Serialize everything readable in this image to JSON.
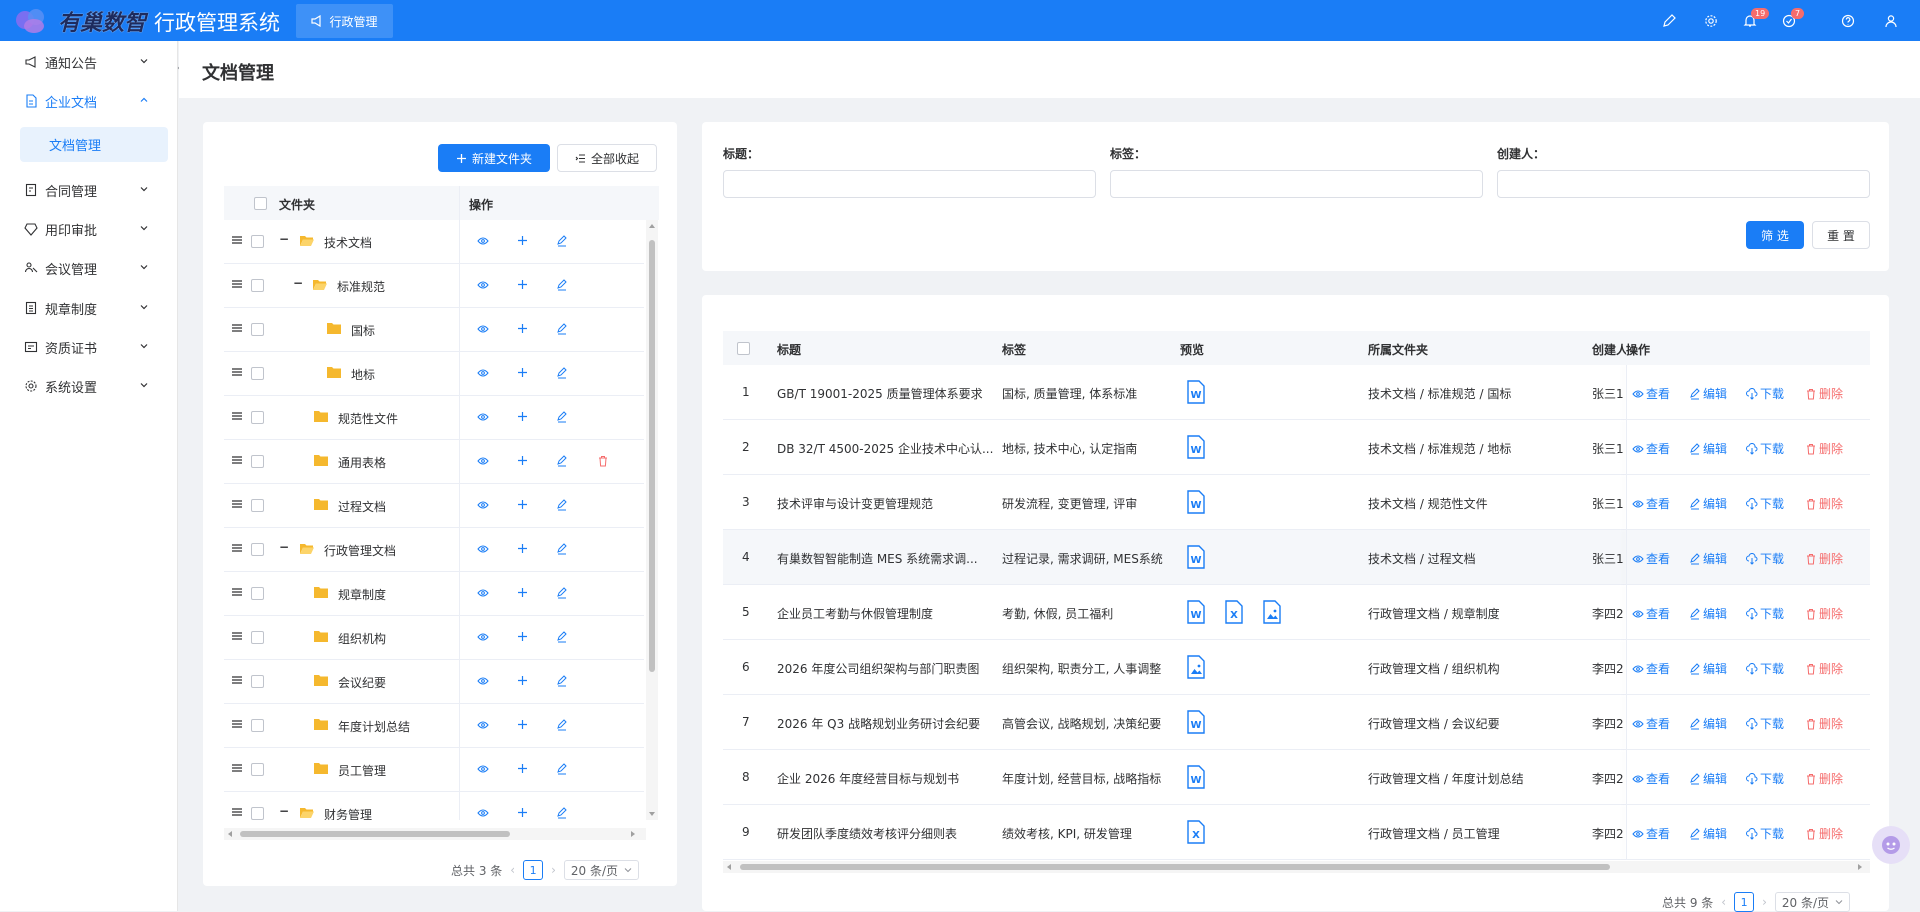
{
  "app": {
    "logo_text": "有巢数智",
    "title": "行政管理系统",
    "top_tab": "行政管理",
    "badges": {
      "notice": "19",
      "task": "7"
    }
  },
  "sidebar": {
    "items": [
      {
        "label": "通知公告",
        "icon": "megaphone-icon"
      },
      {
        "label": "企业文档",
        "icon": "document-icon",
        "active": true
      },
      {
        "label": "合同管理",
        "icon": "contract-icon"
      },
      {
        "label": "用印审批",
        "icon": "seal-icon"
      },
      {
        "label": "会议管理",
        "icon": "meeting-icon"
      },
      {
        "label": "规章制度",
        "icon": "rules-icon"
      },
      {
        "label": "资质证书",
        "icon": "certificate-icon"
      },
      {
        "label": "系统设置",
        "icon": "gear-icon"
      }
    ],
    "sub_active": "文档管理"
  },
  "page": {
    "title": "文档管理"
  },
  "folder_panel": {
    "new_folder": "新建文件夹",
    "collapse_all": "全部收起",
    "col_folder": "文件夹",
    "col_ops": "操作",
    "rows": [
      {
        "name": "技术文档",
        "level": 0,
        "expanded": true,
        "open": true
      },
      {
        "name": "标准规范",
        "level": 1,
        "expanded": true,
        "open": true
      },
      {
        "name": "国标",
        "level": 2
      },
      {
        "name": "地标",
        "level": 2
      },
      {
        "name": "规范性文件",
        "level": 1
      },
      {
        "name": "通用表格",
        "level": 1,
        "deletable": true
      },
      {
        "name": "过程文档",
        "level": 1
      },
      {
        "name": "行政管理文档",
        "level": 0,
        "expanded": true,
        "open": true
      },
      {
        "name": "规章制度",
        "level": 1
      },
      {
        "name": "组织机构",
        "level": 1
      },
      {
        "name": "会议纪要",
        "level": 1
      },
      {
        "name": "年度计划总结",
        "level": 1
      },
      {
        "name": "员工管理",
        "level": 1
      },
      {
        "name": "财务管理",
        "level": 0,
        "expanded": true,
        "open": true
      }
    ],
    "total": "总共 3 条",
    "page": "1",
    "page_size": "20 条/页"
  },
  "filter": {
    "title_label": "标题：",
    "tag_label": "标签：",
    "creator_label": "创建人：",
    "filter_btn": "筛 选",
    "reset_btn": "重 置"
  },
  "doc_table": {
    "headers": {
      "title": "标题",
      "tag": "标签",
      "preview": "预览",
      "folder": "所属文件夹",
      "creator": "创建人",
      "ops": "操作"
    },
    "actions": {
      "view": "查看",
      "edit": "编辑",
      "download": "下载",
      "delete": "删除"
    },
    "rows": [
      {
        "no": "1",
        "title": "GB/T 19001-2025 质量管理体系要求",
        "tag": "国标, 质量管理, 体系标准",
        "preview": [
          "W"
        ],
        "folder": "技术文档 / 标准规范 / 国标",
        "creator": "张三1"
      },
      {
        "no": "2",
        "title": "DB 32/T 4500-2025 企业技术中心认...",
        "tag": "地标, 技术中心, 认定指南",
        "preview": [
          "W"
        ],
        "folder": "技术文档 / 标准规范 / 地标",
        "creator": "张三1"
      },
      {
        "no": "3",
        "title": "技术评审与设计变更管理规范",
        "tag": "研发流程, 变更管理, 评审",
        "preview": [
          "W"
        ],
        "folder": "技术文档 / 规范性文件",
        "creator": "张三1"
      },
      {
        "no": "4",
        "title": "有巢数智智能制造 MES 系统需求调...",
        "tag": "过程记录, 需求调研, MES系统",
        "preview": [
          "W"
        ],
        "folder": "技术文档 / 过程文档",
        "creator": "张三1"
      },
      {
        "no": "5",
        "title": "企业员工考勤与休假管理制度",
        "tag": "考勤, 休假, 员工福利",
        "preview": [
          "W",
          "X",
          "IMG"
        ],
        "folder": "行政管理文档 / 规章制度",
        "creator": "李四2"
      },
      {
        "no": "6",
        "title": "2026 年度公司组织架构与部门职责图",
        "tag": "组织架构, 职责分工, 人事调整",
        "preview": [
          "IMG"
        ],
        "folder": "行政管理文档 / 组织机构",
        "creator": "李四2"
      },
      {
        "no": "7",
        "title": "2026 年 Q3 战略规划业务研讨会纪要",
        "tag": "高管会议, 战略规划, 决策纪要",
        "preview": [
          "W"
        ],
        "folder": "行政管理文档 / 会议纪要",
        "creator": "李四2"
      },
      {
        "no": "8",
        "title": "企业 2026 年度经营目标与规划书",
        "tag": "年度计划, 经营目标, 战略指标",
        "preview": [
          "W"
        ],
        "folder": "行政管理文档 / 年度计划总结",
        "creator": "李四2"
      },
      {
        "no": "9",
        "title": "研发团队季度绩效考核评分细则表",
        "tag": "绩效考核, KPI, 研发管理",
        "preview": [
          "X"
        ],
        "folder": "行政管理文档 / 员工管理",
        "creator": "李四2"
      }
    ],
    "total": "总共 9 条",
    "page": "1",
    "page_size": "20 条/页"
  },
  "colors": {
    "primary": "#1a7df6",
    "danger": "#f56c6c",
    "folder": "#f5b82e"
  }
}
